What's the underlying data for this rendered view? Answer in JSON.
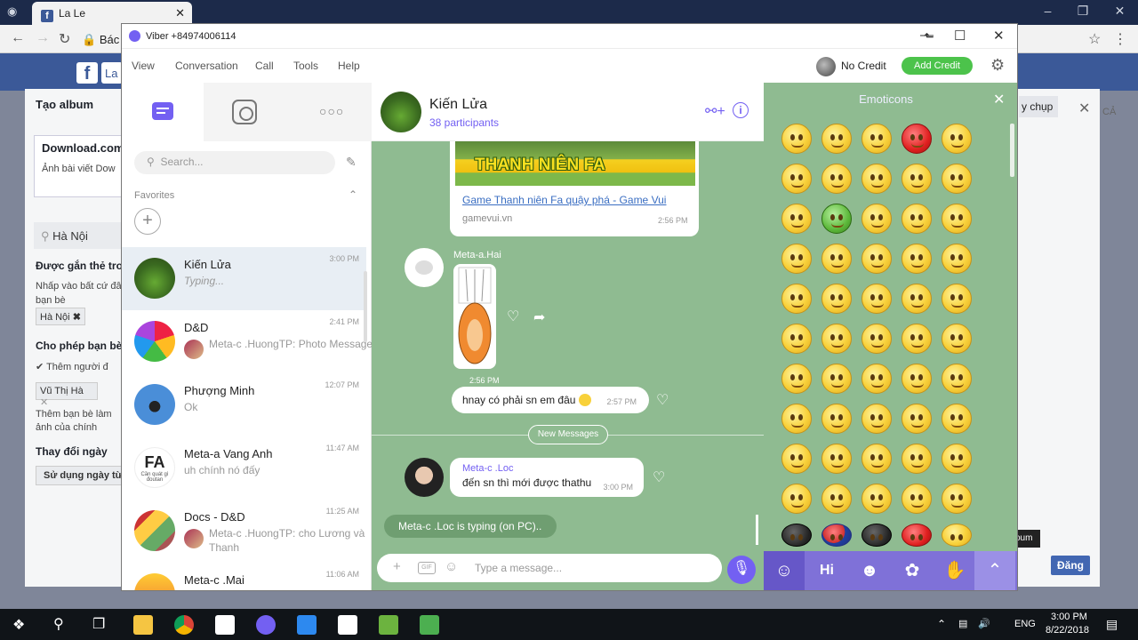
{
  "browser": {
    "tab_title": "La Le",
    "omnibox_text": "Bác",
    "facebook_logo": "f",
    "album_dialog": {
      "title": "Tạo album",
      "card_title": "Download.com",
      "card_desc": "Ảnh bài viết Dow",
      "location": "Hà Nội",
      "tagged_label": "Được gắn thẻ tron",
      "tag_hint_1": "Nhấp vào bất cứ đâ",
      "tag_hint_2": "bạn bè",
      "tag_chip": "Hà Nội",
      "allow_label": "Cho phép bạn bè",
      "add_people_label": "Thêm người đ",
      "friend_chip": "Vũ Thị Hà",
      "friends_hint_1": "Thêm bạn bè làm",
      "friends_hint_2": "ảnh của chính",
      "change_date_label": "Thay đổi ngày",
      "use_date_button": "Sử dụng ngày từ"
    },
    "right_panel": {
      "button": "y chụp",
      "corner_text": "CẢ",
      "post_button": "Đăng",
      "tooltip": "oum"
    }
  },
  "viber": {
    "window_title": "Viber +84974006114",
    "menu": [
      "View",
      "Conversation",
      "Call",
      "Tools",
      "Help"
    ],
    "credit_label": "No Credit",
    "add_credit_label": "Add Credit",
    "search_placeholder": "Search...",
    "favorites_label": "Favorites",
    "chats": [
      {
        "name": "Kiến Lửa",
        "time": "3:00 PM",
        "preview": "Typing...",
        "sender": ""
      },
      {
        "name": "D&D",
        "time": "2:41 PM",
        "preview": "Meta-c .HuongTP: Photo Message",
        "sender": "mini"
      },
      {
        "name": "Phượng Minh",
        "time": "12:07 PM",
        "preview": "Ok",
        "sender": ""
      },
      {
        "name": "Meta-a Vang Anh",
        "time": "11:47 AM",
        "preview": "uh chính nó đấy",
        "sender": ""
      },
      {
        "name": "Docs - D&D",
        "time": "11:25 AM",
        "preview": "Meta-c .HuongTP: cho Lương và Thanh",
        "sender": "mini"
      },
      {
        "name": "Meta-c .Mai",
        "time": "11:06 AM",
        "preview": "",
        "sender": ""
      }
    ],
    "fa_avatar_text": "FA",
    "fa_avatar_sub": "Cần quát gì đoutan",
    "conversation": {
      "name": "Kiến Lửa",
      "participants": "38 participants",
      "link_banner": "THANH NIÊN FA",
      "link_title": "Game Thanh niên Fa quậy phá - Game Vui",
      "link_host": "gamevui.vn",
      "link_time": "2:56 PM",
      "sticker_sender": "Meta-a.Hai",
      "sticker_time": "2:56 PM",
      "message_1": "hnay có phải sn em đâu",
      "message_1_time": "2:57 PM",
      "new_messages_label": "New Messages",
      "message_2_sender": "Meta-c .Loc",
      "message_2": "đến sn thì mới được thathu",
      "message_2_time": "3:00 PM",
      "typing_indicator": "Meta-c .Loc is typing (on PC)..",
      "input_placeholder": "Type a message..."
    },
    "emoticons_title": "Emoticons"
  },
  "taskbar": {
    "language": "ENG",
    "time": "3:00 PM",
    "date": "8/22/2018"
  },
  "colors": {
    "viber_purple": "#7360f2",
    "chat_background": "#8fbb91",
    "add_credit_green": "#4cc34b",
    "facebook_blue": "#3b5998"
  }
}
